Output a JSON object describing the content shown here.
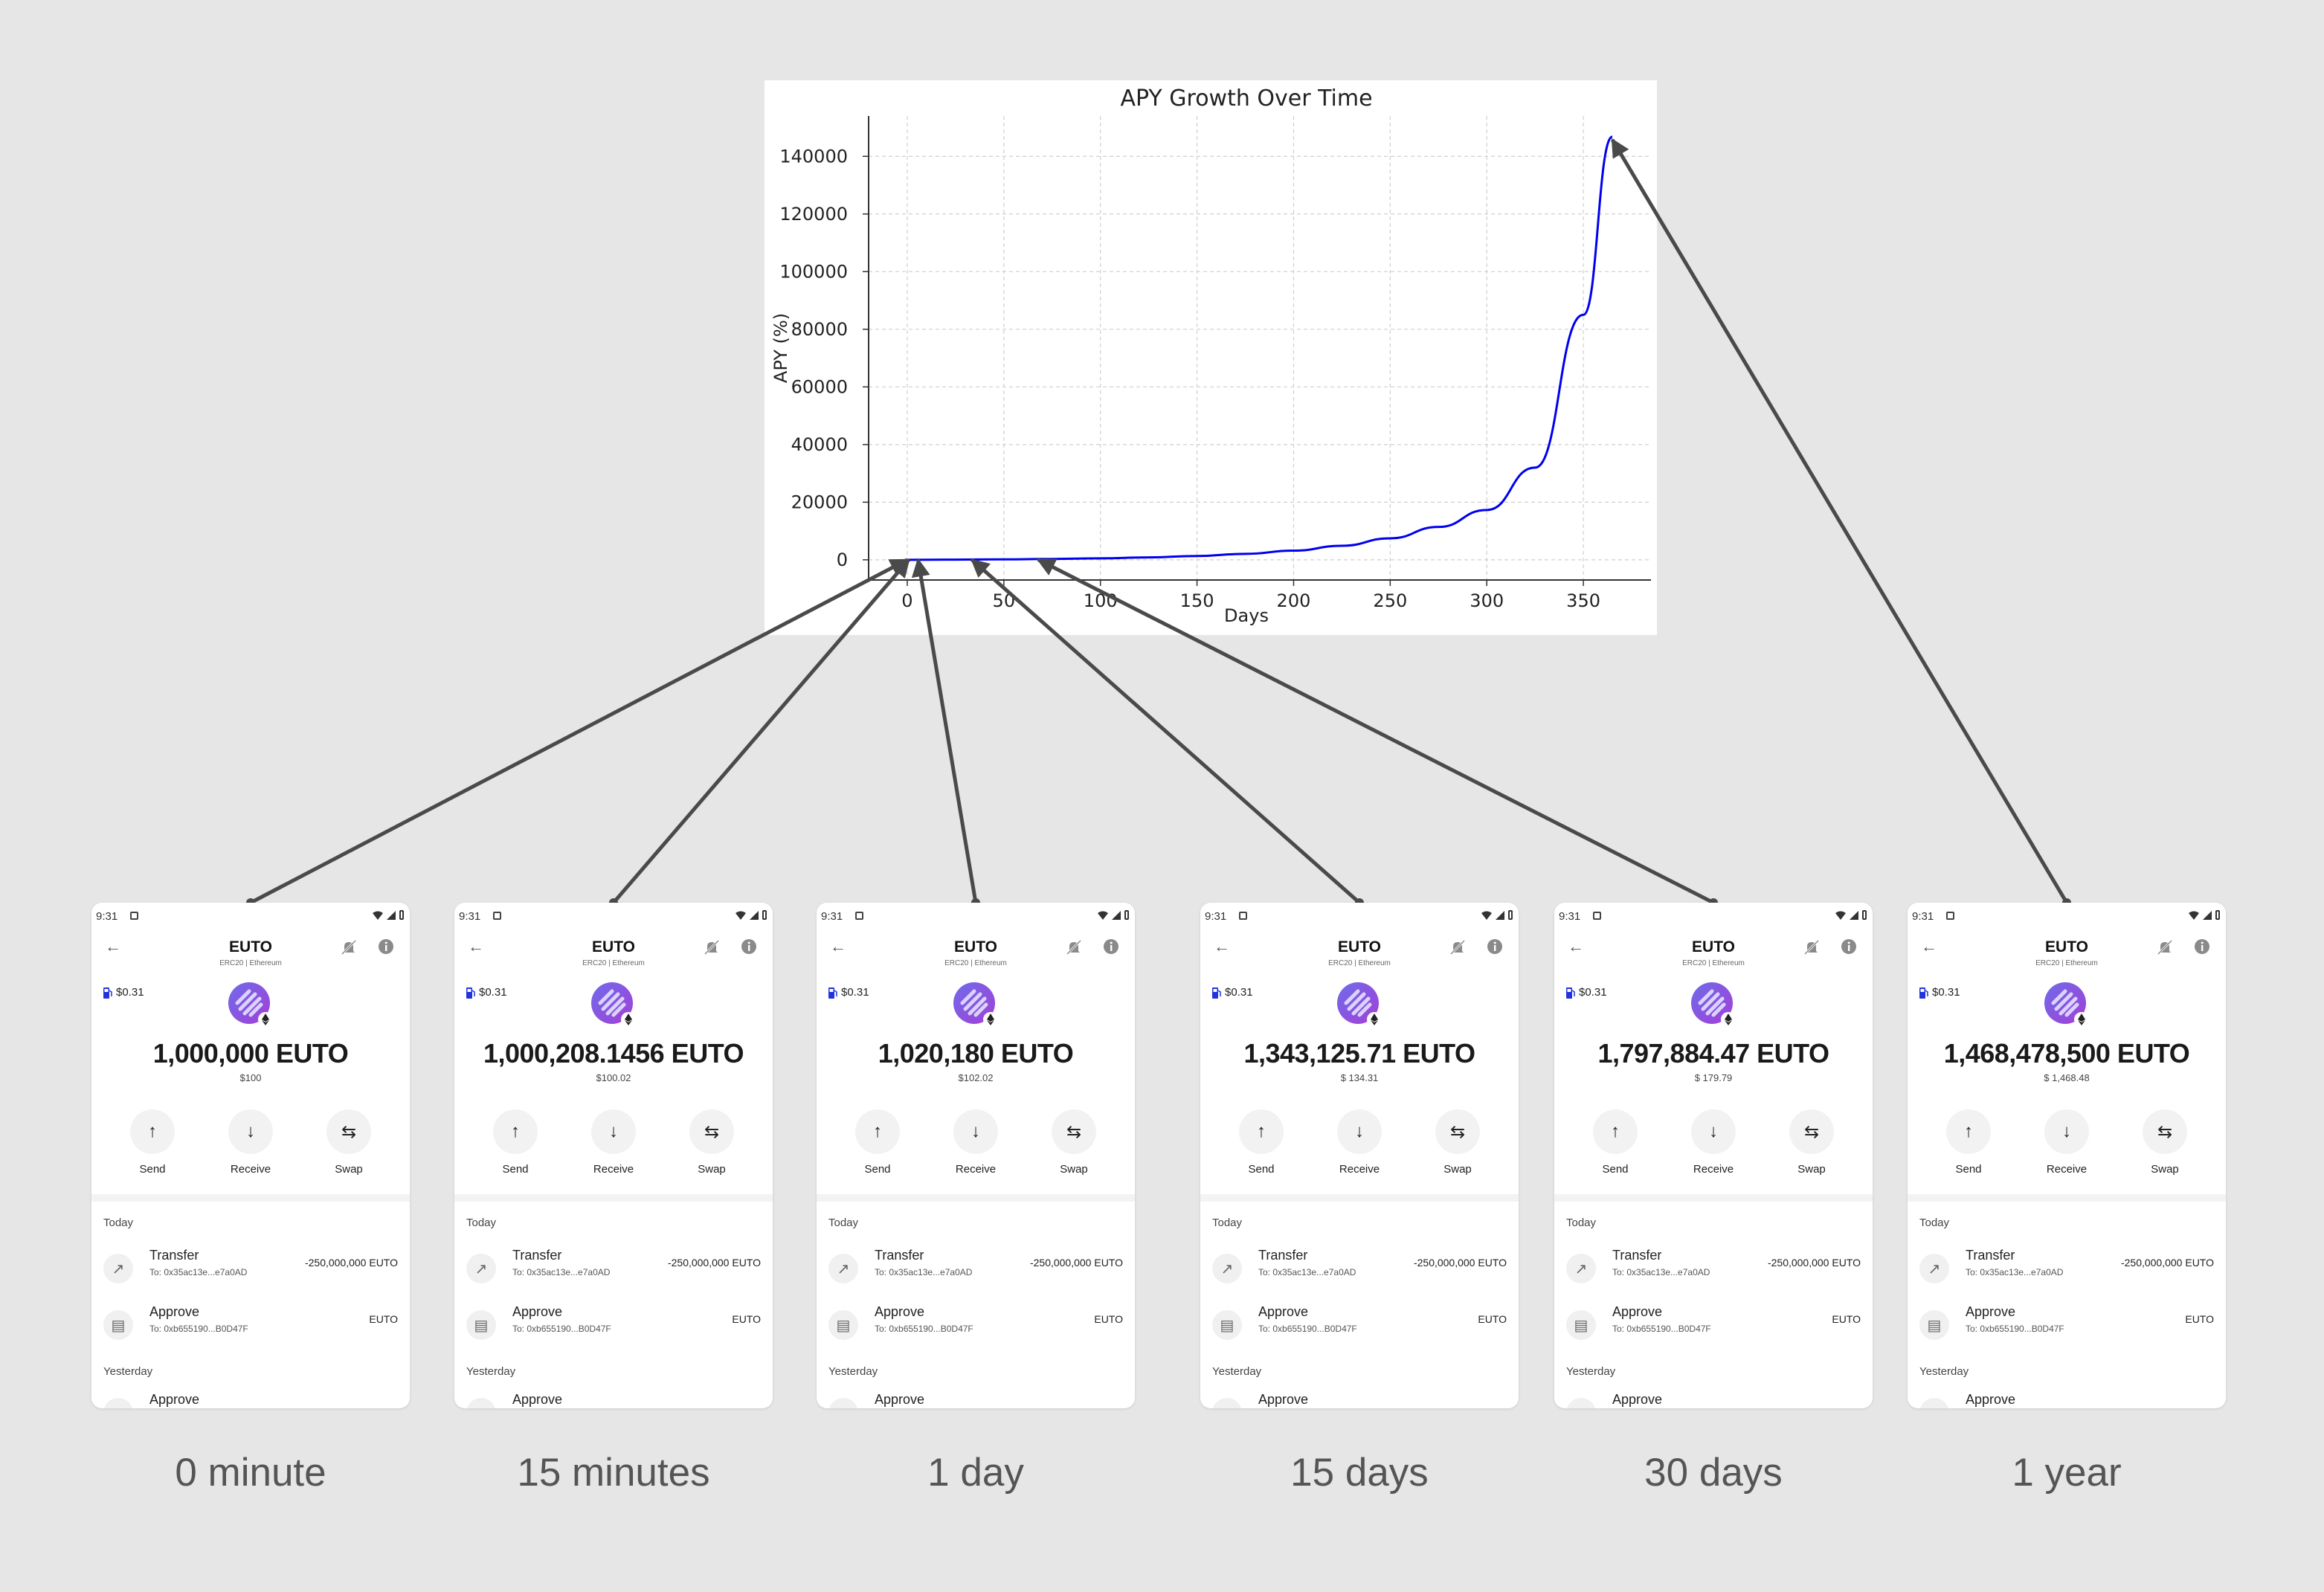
{
  "chart_data": {
    "type": "line",
    "title": "APY Growth Over Time",
    "xlabel": "Days",
    "ylabel": "APY (%)",
    "xlim": [
      -20,
      385
    ],
    "ylim": [
      -7000,
      154000
    ],
    "xticks": [
      0,
      50,
      100,
      150,
      200,
      250,
      300,
      350
    ],
    "yticks": [
      0,
      20000,
      40000,
      60000,
      80000,
      100000,
      120000,
      140000
    ],
    "grid": true,
    "series": [
      {
        "color": "#0000ee",
        "x": [
          0,
          25,
          50,
          75,
          100,
          125,
          150,
          175,
          200,
          225,
          250,
          275,
          300,
          325,
          350,
          365
        ],
        "values": [
          0,
          64,
          160,
          303,
          518,
          840,
          1330,
          2070,
          3180,
          4880,
          7460,
          11400,
          17300,
          32000,
          85000,
          146800
        ]
      }
    ],
    "arrow_targets_days": [
      0,
      0.0104,
      1,
      15,
      30,
      365
    ]
  },
  "phones": [
    {
      "time": "9:31",
      "token": "EUTO",
      "subtitle": "ERC20  |  Ethereum",
      "gas": "$0.31",
      "balance": "1,000,000 EUTO",
      "fiat": "$100",
      "send": "Send",
      "receive": "Receive",
      "swap": "Swap",
      "today": "Today",
      "tx1_title": "Transfer",
      "tx1_sub": "To: 0x35ac13e...e7a0AD",
      "tx1_amount": "-250,000,000 EUTO",
      "tx2_title": "Approve",
      "tx2_sub": "To: 0xb655190...B0D47F",
      "tx2_amount": "EUTO",
      "yesterday": "Yesterday",
      "tx3_title": "Approve",
      "caption": "0 minute"
    },
    {
      "time": "9:31",
      "token": "EUTO",
      "subtitle": "ERC20  |  Ethereum",
      "gas": "$0.31",
      "balance": "1,000,208.1456 EUTO",
      "fiat": "$100.02",
      "send": "Send",
      "receive": "Receive",
      "swap": "Swap",
      "today": "Today",
      "tx1_title": "Transfer",
      "tx1_sub": "To: 0x35ac13e...e7a0AD",
      "tx1_amount": "-250,000,000 EUTO",
      "tx2_title": "Approve",
      "tx2_sub": "To: 0xb655190...B0D47F",
      "tx2_amount": "EUTO",
      "yesterday": "Yesterday",
      "tx3_title": "Approve",
      "caption": "15 minutes"
    },
    {
      "time": "9:31",
      "token": "EUTO",
      "subtitle": "ERC20  |  Ethereum",
      "gas": "$0.31",
      "balance": "1,020,180 EUTO",
      "fiat": "$102.02",
      "send": "Send",
      "receive": "Receive",
      "swap": "Swap",
      "today": "Today",
      "tx1_title": "Transfer",
      "tx1_sub": "To: 0x35ac13e...e7a0AD",
      "tx1_amount": "-250,000,000 EUTO",
      "tx2_title": "Approve",
      "tx2_sub": "To: 0xb655190...B0D47F",
      "tx2_amount": "EUTO",
      "yesterday": "Yesterday",
      "tx3_title": "Approve",
      "caption": "1 day"
    },
    {
      "time": "9:31",
      "token": "EUTO",
      "subtitle": "ERC20  |  Ethereum",
      "gas": "$0.31",
      "balance": "1,343,125.71 EUTO",
      "fiat": "$ 134.31",
      "send": "Send",
      "receive": "Receive",
      "swap": "Swap",
      "today": "Today",
      "tx1_title": "Transfer",
      "tx1_sub": "To: 0x35ac13e...e7a0AD",
      "tx1_amount": "-250,000,000 EUTO",
      "tx2_title": "Approve",
      "tx2_sub": "To: 0xb655190...B0D47F",
      "tx2_amount": "EUTO",
      "yesterday": "Yesterday",
      "tx3_title": "Approve",
      "caption": "15 days"
    },
    {
      "time": "9:31",
      "token": "EUTO",
      "subtitle": "ERC20  |  Ethereum",
      "gas": "$0.31",
      "balance": "1,797,884.47 EUTO",
      "fiat": "$ 179.79",
      "send": "Send",
      "receive": "Receive",
      "swap": "Swap",
      "today": "Today",
      "tx1_title": "Transfer",
      "tx1_sub": "To: 0x35ac13e...e7a0AD",
      "tx1_amount": "-250,000,000 EUTO",
      "tx2_title": "Approve",
      "tx2_sub": "To: 0xb655190...B0D47F",
      "tx2_amount": "EUTO",
      "yesterday": "Yesterday",
      "tx3_title": "Approve",
      "caption": "30 days"
    },
    {
      "time": "9:31",
      "token": "EUTO",
      "subtitle": "ERC20  |  Ethereum",
      "gas": "$0.31",
      "balance": "1,468,478,500 EUTO",
      "fiat": "$ 1,468.48",
      "send": "Send",
      "receive": "Receive",
      "swap": "Swap",
      "today": "Today",
      "tx1_title": "Transfer",
      "tx1_sub": "To: 0x35ac13e...e7a0AD",
      "tx1_amount": "-250,000,000 EUTO",
      "tx2_title": "Approve",
      "tx2_sub": "To: 0xb655190...B0D47F",
      "tx2_amount": "EUTO",
      "yesterday": "Yesterday",
      "tx3_title": "Approve",
      "caption": "1 year"
    }
  ]
}
